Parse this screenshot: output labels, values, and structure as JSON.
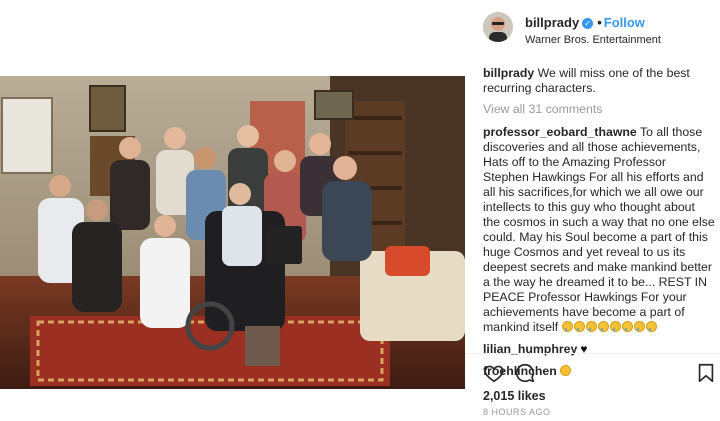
{
  "post": {
    "header": {
      "username": "billprady",
      "follow_label": "Follow",
      "dot": "•",
      "location": "Warner Bros. Entertainment"
    },
    "caption": {
      "username": "billprady",
      "text": "We will miss one of the best recurring characters."
    },
    "view_all_label": "View all 31 comments",
    "comments": [
      {
        "username": "professor_eobard_thawne",
        "text": "To all those discoveries and all those achievements, Hats off to the Amazing Professor Stephen Hawkings For all his efforts and all his sacrifices,for which we all owe our intellects to this guy who thought about the cosmos in such a way that no one else could. May his Soul become a part of this huge Cosmos and yet reveal to us its deepest secrets and make mankind better a the way he dreamed it to be... REST IN PEACE Professor Hawkings For your achievements have become a part of mankind itself",
        "emoji": "crying-face",
        "emoji_count": 8
      },
      {
        "username": "lilian_humphrey",
        "text": "",
        "emoji": "black-heart"
      },
      {
        "username": "froehlinchen",
        "text": "",
        "emoji": "sad-face"
      }
    ],
    "likes_label": "2,015 likes",
    "time_label": "8 HOURS AGO",
    "icons": {
      "like": "heart-outline-icon",
      "comment": "comment-bubble-icon",
      "save": "bookmark-icon",
      "verified": "verified-badge-icon"
    },
    "colors": {
      "link": "#3897f0",
      "muted": "#999999",
      "text": "#262626"
    }
  }
}
